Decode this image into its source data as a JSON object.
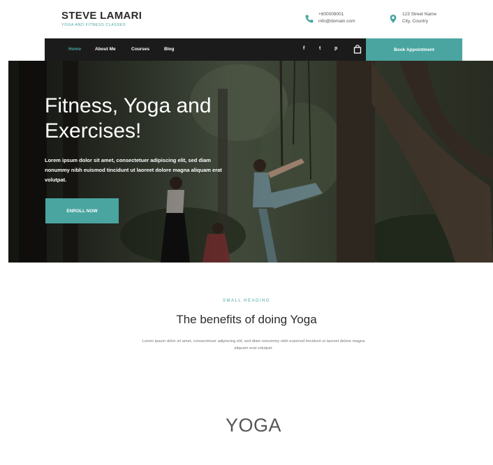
{
  "brand": {
    "name": "STEVE LAMARI",
    "tagline": "YOGA AND FITNESS CLASSES"
  },
  "contact": {
    "phone": {
      "icon": "phone-icon",
      "line1": "+800008001",
      "line2": "info@domain.com"
    },
    "address": {
      "icon": "location-pin-icon",
      "line1": "123 Street Name",
      "line2": "City, Country"
    }
  },
  "nav": {
    "items": [
      {
        "label": "Home",
        "active": true
      },
      {
        "label": "About Me",
        "active": false
      },
      {
        "label": "Courses",
        "active": false
      },
      {
        "label": "Blog",
        "active": false
      }
    ],
    "social": [
      {
        "icon": "facebook-icon",
        "glyph": "f"
      },
      {
        "icon": "twitter-icon",
        "glyph": "t"
      },
      {
        "icon": "pinterest-icon",
        "glyph": "p"
      }
    ],
    "cart_icon": "cart-icon",
    "book_button": "Book Appointment"
  },
  "hero": {
    "title": "Fitness, Yoga and Exercises!",
    "text": "Lorem ipsum dolor sit amet, consectetuer adipiscing elit, sed diam nonummy nibh euismod tincidunt ut laoreet dolore magna aliquam erat volutpat.",
    "button": "ENROLL NOW"
  },
  "benefits": {
    "small_heading": "SMALL HEADING",
    "title": "The benefits of doing Yoga",
    "text": "Lorem ipsum dolor sit amet, consectetuer adipiscing elit, sed diam nonummy nibh euismod tincidunt ut laoreet dolore magna aliquam erat volutpat."
  },
  "yoga_heading": "YOGA",
  "colors": {
    "accent": "#4aa5a0",
    "nav_bg": "#1b1b1b",
    "text_dark": "#2b2b2b"
  }
}
